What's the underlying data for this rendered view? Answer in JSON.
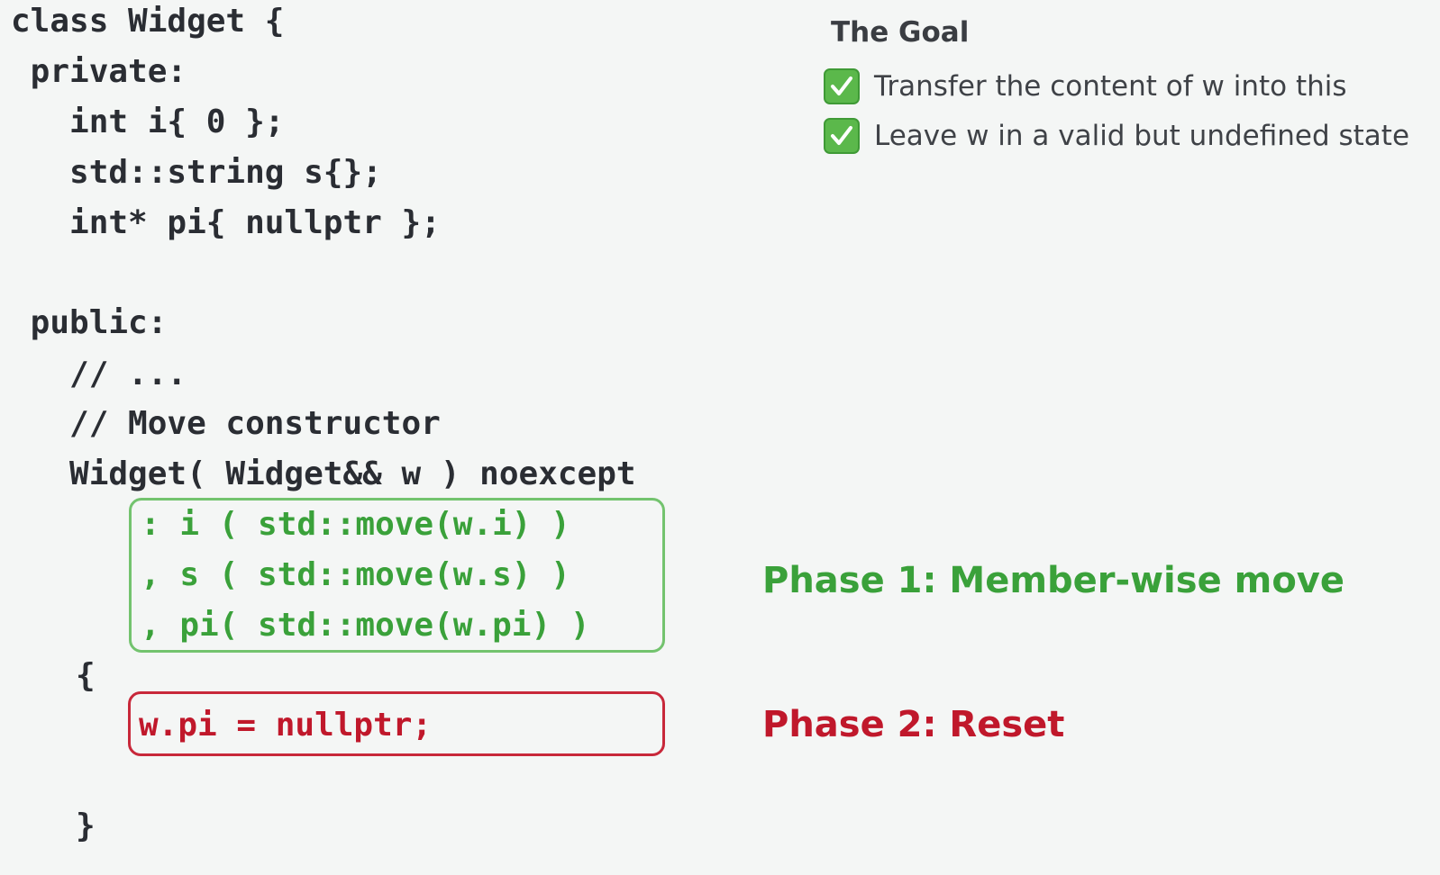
{
  "code": {
    "lines": [
      "class Widget {",
      " private:",
      "   int i{ 0 };",
      "   std::string s{};",
      "   int* pi{ nullptr };",
      "",
      " public:",
      "   // ...",
      "   // Move constructor",
      "   Widget( Widget&& w ) noexcept"
    ],
    "init_lines": [
      ": i ( std::move(w.i) )",
      ", s ( std::move(w.s) )",
      ", pi( std::move(w.pi) )"
    ],
    "open_brace": "{",
    "reset_line": "w.pi = nullptr;",
    "close_brace": "}"
  },
  "goal": {
    "title": "The Goal",
    "items": [
      "Transfer the content of w into this",
      "Leave w in a valid but undefined state"
    ]
  },
  "phases": {
    "phase1": "Phase 1: Member-wise move",
    "phase2": "Phase 2: Reset"
  },
  "colors": {
    "background": "#f4f6f5",
    "code": "#2a2d33",
    "green": "#3aa13a",
    "red": "#c0182b",
    "check_bg": "#5bb84b"
  }
}
